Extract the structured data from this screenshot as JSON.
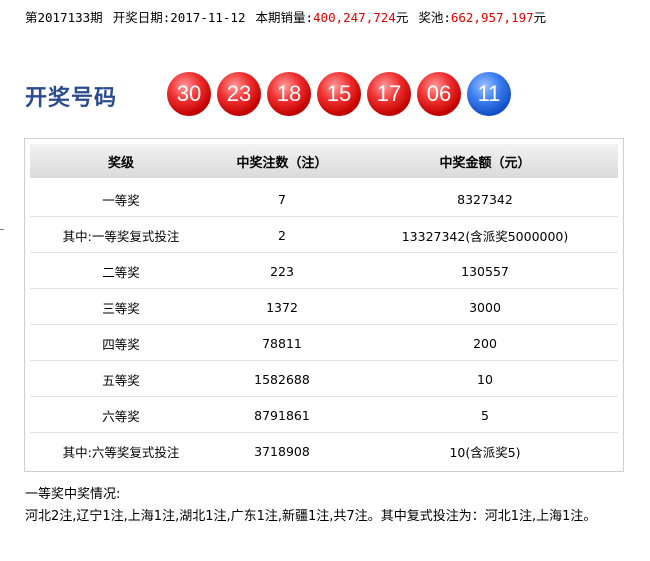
{
  "header": {
    "issue": "第2017133期",
    "date_label": "开奖日期:",
    "date": "2017-11-12",
    "sales_label": "本期销量:",
    "sales": "400,247,724",
    "sales_unit": "元",
    "pool_label": "奖池:",
    "pool": "662,957,197",
    "pool_unit": "元"
  },
  "draw": {
    "label": "开奖号码",
    "red_balls": [
      "30",
      "23",
      "18",
      "15",
      "17",
      "06"
    ],
    "blue_ball": "11",
    "colors": {
      "red": "#e01818",
      "blue": "#1a5ad8",
      "label": "#2a4c8f",
      "highlight": "#e00000"
    }
  },
  "table": {
    "headers": [
      "奖级",
      "中奖注数（注）",
      "中奖金额（元）"
    ],
    "rows": [
      [
        "一等奖",
        "7",
        "8327342"
      ],
      [
        "其中:一等奖复式投注",
        "2",
        "13327342(含派奖5000000)"
      ],
      [
        "二等奖",
        "223",
        "130557"
      ],
      [
        "三等奖",
        "1372",
        "3000"
      ],
      [
        "四等奖",
        "78811",
        "200"
      ],
      [
        "五等奖",
        "1582688",
        "10"
      ],
      [
        "六等奖",
        "8791861",
        "5"
      ],
      [
        "其中:六等奖复式投注",
        "3718908",
        "10(含派奖5)"
      ]
    ]
  },
  "detail": {
    "title": "一等奖中奖情况:",
    "text": "河北2注,辽宁1注,上海1注,湖北1注,广东1注,新疆1注,共7注。其中复式投注为：河北1注,上海1注。"
  }
}
